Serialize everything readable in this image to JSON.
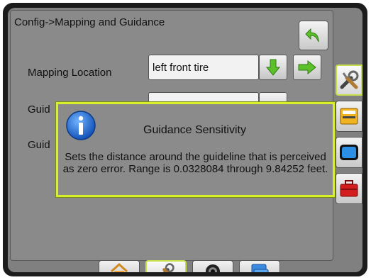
{
  "header": {
    "title": "Config->Mapping and Guidance"
  },
  "rows": [
    {
      "label": "Mapping Location",
      "value": "left front tire"
    },
    {
      "label": "Guid",
      "value": ""
    },
    {
      "label": "Guid",
      "value": ""
    }
  ],
  "dialog": {
    "title": "Guidance Sensitivity",
    "message": "Sets the distance around the guideline that is perceived as zero error. Range is 0.0328084 through 9.84252 feet."
  },
  "icons": {
    "back": "back-arrow-icon",
    "down": "green-down-arrow-icon",
    "right": "green-right-arrow-icon",
    "info": "info-icon",
    "sidebar": [
      "tools-icon",
      "console-icon",
      "display-icon",
      "toolbox-icon"
    ],
    "bottom": [
      "home-icon",
      "tools-icon",
      "camera-icon",
      "layers-icon"
    ]
  },
  "colors": {
    "highlight": "#d8f02a",
    "arrow_green": "#5cc02a",
    "screen_gray": "#8a8a8a",
    "info_blue": "#1f6fd1"
  }
}
